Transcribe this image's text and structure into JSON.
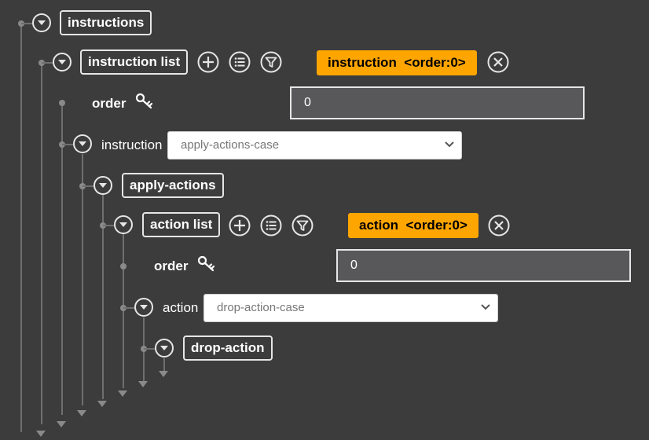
{
  "tree": {
    "instructions": {
      "label": "instructions"
    },
    "instruction_list": {
      "label": "instruction list",
      "badge": "instruction  <order:0>",
      "order_label": "order",
      "order_value": "0"
    },
    "instruction": {
      "label": "instruction",
      "select_value": "apply-actions-case"
    },
    "apply_actions": {
      "label": "apply-actions"
    },
    "action_list": {
      "label": "action list",
      "badge": "action  <order:0>",
      "order_label": "order",
      "order_value": "0"
    },
    "action": {
      "label": "action",
      "select_value": "drop-action-case"
    },
    "drop_action": {
      "label": "drop-action"
    }
  },
  "icons": {
    "toggle": "chevron-down-circle-icon",
    "add": "plus-circle-icon",
    "list": "list-circle-icon",
    "filter": "filter-circle-icon",
    "remove": "close-circle-icon",
    "key": "key-icon"
  },
  "colors": {
    "background": "#3c3c3d",
    "badge": "#ffa500",
    "line": "#6f6f6f"
  }
}
